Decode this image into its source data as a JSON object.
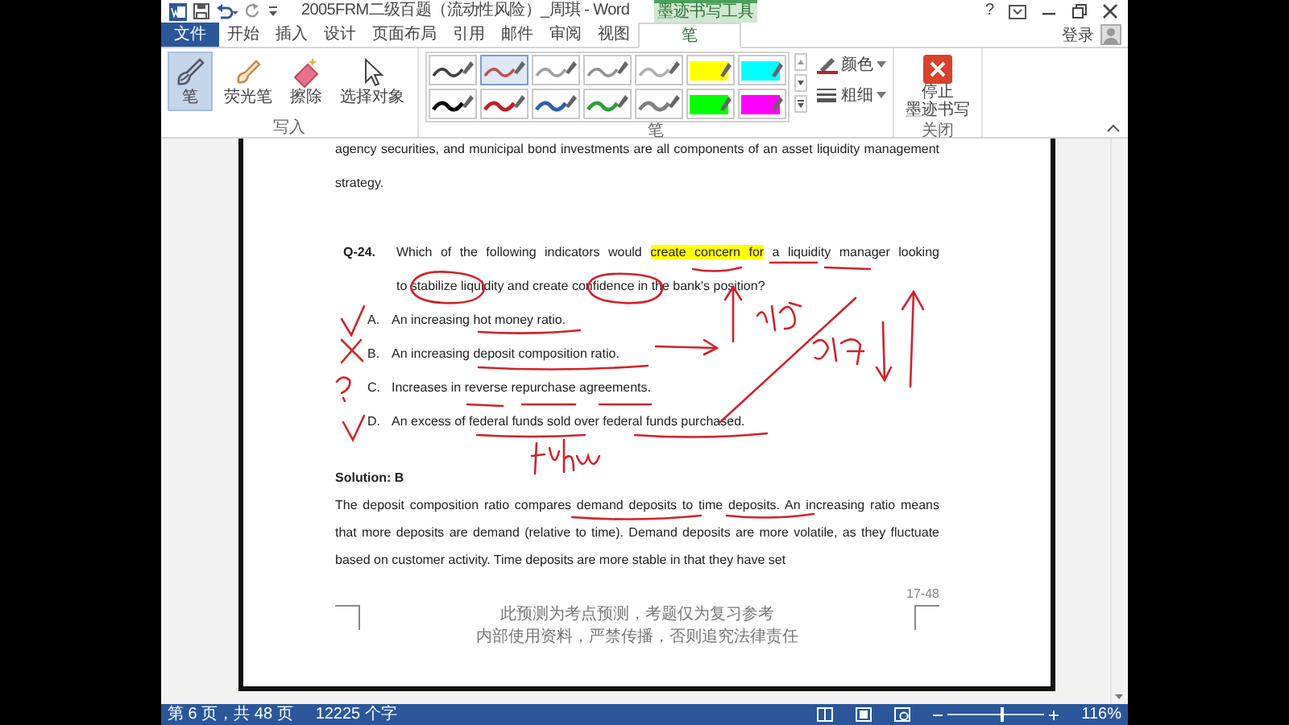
{
  "title_bar": {
    "title": "2005FRM二级百题（流动性风险）_周琪 - Word",
    "context_label": "墨迹书写工具",
    "help": "?"
  },
  "tabs": [
    {
      "label": "文件",
      "kind": "file",
      "selected": false
    },
    {
      "label": "开始",
      "kind": "normal",
      "selected": false
    },
    {
      "label": "插入",
      "kind": "normal",
      "selected": false
    },
    {
      "label": "设计",
      "kind": "normal",
      "selected": false
    },
    {
      "label": "页面布局",
      "kind": "normal",
      "selected": false
    },
    {
      "label": "引用",
      "kind": "normal",
      "selected": false
    },
    {
      "label": "邮件",
      "kind": "normal",
      "selected": false
    },
    {
      "label": "审阅",
      "kind": "normal",
      "selected": false
    },
    {
      "label": "视图",
      "kind": "normal",
      "selected": false
    },
    {
      "label": "笔",
      "kind": "contextual",
      "selected": true
    }
  ],
  "account": {
    "label": "登录"
  },
  "ribbon": {
    "groups": [
      {
        "label": "写入",
        "kind": "tools",
        "tools": [
          {
            "label": "笔",
            "kind": "pen",
            "selected": true
          },
          {
            "label": "荧光笔",
            "kind": "highlighter",
            "selected": false
          },
          {
            "label": "擦除",
            "kind": "eraser",
            "selected": false
          },
          {
            "label": "选择对象",
            "kind": "pointer",
            "selected": false
          }
        ]
      },
      {
        "label": "笔",
        "kind": "pens",
        "pens": [
          {
            "kind": "pen",
            "color": "#404040",
            "selected": false
          },
          {
            "kind": "pen",
            "color": "#c0504d",
            "selected": true
          },
          {
            "kind": "pen",
            "color": "#a0a0a0",
            "selected": false
          },
          {
            "kind": "pen",
            "color": "#909090",
            "selected": false
          },
          {
            "kind": "pen",
            "color": "#b0b0b0",
            "selected": false
          },
          {
            "kind": "highlighter",
            "color": "#ffff00",
            "selected": false
          },
          {
            "kind": "highlighter",
            "color": "#00ffff",
            "selected": false
          },
          {
            "kind": "pen",
            "color": "#000000",
            "selected": false
          },
          {
            "kind": "pen",
            "color": "#c0202a",
            "selected": false
          },
          {
            "kind": "pen",
            "color": "#2e5fb0",
            "selected": false
          },
          {
            "kind": "pen",
            "color": "#2e9e3e",
            "selected": false
          },
          {
            "kind": "pen",
            "color": "#808080",
            "selected": false
          },
          {
            "kind": "highlighter",
            "color": "#00ff00",
            "selected": false
          },
          {
            "kind": "highlighter",
            "color": "#ff00ff",
            "selected": false
          }
        ],
        "options": [
          {
            "label": "颜色",
            "kind": "color"
          },
          {
            "label": "粗细",
            "kind": "thickness"
          }
        ]
      },
      {
        "label": "关闭",
        "kind": "close",
        "button": {
          "label_lines": [
            "停止",
            "墨迹书写"
          ]
        }
      }
    ]
  },
  "document": {
    "top_paragraph": "agency securities, and municipal bond investments are all components of an asset liquidity management strategy.",
    "question": {
      "number": "Q-24.",
      "lines": [
        {
          "parts": [
            {
              "text": "Which of the following indicators would ",
              "highlight": false
            },
            {
              "text": "create concern for",
              "highlight": true
            },
            {
              "text": " a liquidity manager looking",
              "highlight": false
            }
          ]
        },
        {
          "parts": [
            {
              "text": "to stabilize liquidity and create confidence in the bank's position?",
              "highlight": false
            }
          ]
        }
      ]
    },
    "options": [
      {
        "letter": "A.",
        "text": "An increasing hot money ratio."
      },
      {
        "letter": "B.",
        "text": "An increasing deposit composition ratio."
      },
      {
        "letter": "C.",
        "text": "Increases in reverse repurchase agreements."
      },
      {
        "letter": "D.",
        "text": "An excess of federal funds sold over federal funds purchased."
      }
    ],
    "solution_heading": "Solution: B",
    "solution_text": "The deposit composition ratio compares demand deposits to time deposits. An increasing ratio means that more deposits are demand (relative to time). Demand deposits are more volatile, as they fluctuate based on customer activity. Time deposits are more stable in that they have set",
    "page_number": "17-48",
    "footer_lines": [
      "此预测为考点预测，考题仅为复习参考",
      "内部使用资料，严禁传播，否则追究法律责任"
    ]
  },
  "status_bar": {
    "page": "第 6 页，共 48 页",
    "words": "12225 个字",
    "zoom": {
      "level": 0.55,
      "label": "116%"
    }
  }
}
